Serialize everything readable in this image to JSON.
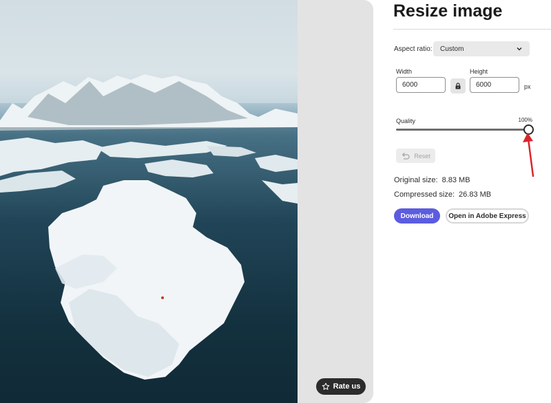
{
  "preview": {
    "image_alt": "Aerial winter landscape of snow-covered islands and mountains",
    "rate_label": "Rate us"
  },
  "panel": {
    "title": "Resize image",
    "aspect_ratio_label": "Aspect ratio:",
    "aspect_ratio_value": "Custom",
    "width_label": "Width",
    "width_value": "6000",
    "height_label": "Height",
    "height_value": "6000",
    "unit": "px",
    "quality_label": "Quality",
    "quality_value_text": "100%",
    "quality_percent": 100,
    "reset_label": "Reset",
    "original_size_label": "Original size:",
    "original_size_value": "8.83 MB",
    "compressed_size_label": "Compressed size:",
    "compressed_size_value": "26.83 MB",
    "download_label": "Download",
    "open_express_label": "Open in Adobe Express"
  },
  "colors": {
    "accent": "#5c5ce0",
    "annotation": "#d9262b",
    "text": "#2c2c2c"
  },
  "icons": {
    "rate": "star-icon",
    "lock": "lock-icon",
    "dropdown": "chevron-down-icon",
    "reset": "undo-icon"
  }
}
